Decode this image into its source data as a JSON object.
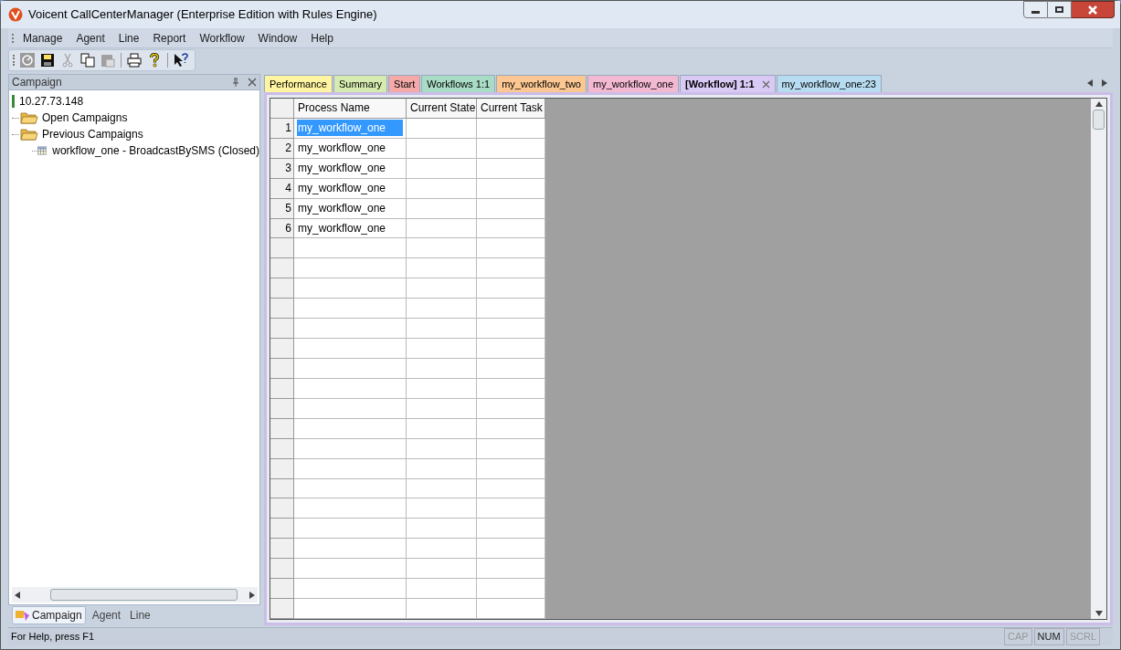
{
  "window": {
    "title": "Voicent CallCenterManager (Enterprise Edition with Rules Engine)"
  },
  "menu": [
    "Manage",
    "Agent",
    "Line",
    "Report",
    "Workflow",
    "Window",
    "Help"
  ],
  "toolbar": [
    {
      "kind": "monitor",
      "disabled": false
    },
    {
      "kind": "save",
      "disabled": false
    },
    {
      "kind": "cut",
      "disabled": true
    },
    {
      "kind": "copy",
      "disabled": false
    },
    {
      "kind": "paste",
      "disabled": true
    },
    {
      "kind": "sep"
    },
    {
      "kind": "print",
      "disabled": false
    },
    {
      "kind": "help",
      "disabled": false
    },
    {
      "kind": "sep"
    },
    {
      "kind": "whatsthis",
      "disabled": false
    }
  ],
  "side_panel": {
    "title": "Campaign",
    "tree": [
      {
        "label": "10.27.73.148",
        "kind": "server"
      },
      {
        "label": "Open Campaigns",
        "kind": "folder"
      },
      {
        "label": "Previous Campaigns",
        "kind": "folder",
        "children": [
          {
            "label": "workflow_one - BroadcastBySMS (Closed)",
            "kind": "campaign"
          }
        ]
      }
    ],
    "bottom_tabs": [
      {
        "label": "Campaign",
        "selected": true
      },
      {
        "label": "Agent",
        "selected": false
      },
      {
        "label": "Line",
        "selected": false
      }
    ]
  },
  "tabs": [
    {
      "label": "Performance",
      "color": "#fff5a0",
      "selected": false
    },
    {
      "label": "Summary",
      "color": "#d6ebb0",
      "selected": false
    },
    {
      "label": "Start",
      "color": "#f5a9a9",
      "selected": false
    },
    {
      "label": "Workflows 1:1",
      "color": "#a9dcc6",
      "selected": false
    },
    {
      "label": "my_workflow_two",
      "color": "#fcc792",
      "selected": false
    },
    {
      "label": "my_workflow_one",
      "color": "#f3b9d2",
      "selected": false
    },
    {
      "label": "[Workflow] 1:1",
      "color": "#d9c9f5",
      "selected": true
    },
    {
      "label": "my_workflow_one:23",
      "color": "#b7dbf0",
      "selected": false
    }
  ],
  "table": {
    "columns": [
      "Process Name",
      "Current State",
      "Current Task"
    ],
    "rows": [
      {
        "number": "1",
        "cells": [
          "my_workflow_one",
          "",
          ""
        ],
        "selected": true
      },
      {
        "number": "2",
        "cells": [
          "my_workflow_one",
          "",
          ""
        ],
        "selected": false
      },
      {
        "number": "3",
        "cells": [
          "my_workflow_one",
          "",
          ""
        ],
        "selected": false
      },
      {
        "number": "4",
        "cells": [
          "my_workflow_one",
          "",
          ""
        ],
        "selected": false
      },
      {
        "number": "5",
        "cells": [
          "my_workflow_one",
          "",
          ""
        ],
        "selected": false
      },
      {
        "number": "6",
        "cells": [
          "my_workflow_one",
          "",
          ""
        ],
        "selected": false
      }
    ]
  },
  "status_bar": {
    "text": "For Help, press F1",
    "indicators": [
      {
        "label": "CAP",
        "on": false
      },
      {
        "label": "NUM",
        "on": true
      },
      {
        "label": "SCRL",
        "on": false
      }
    ]
  }
}
